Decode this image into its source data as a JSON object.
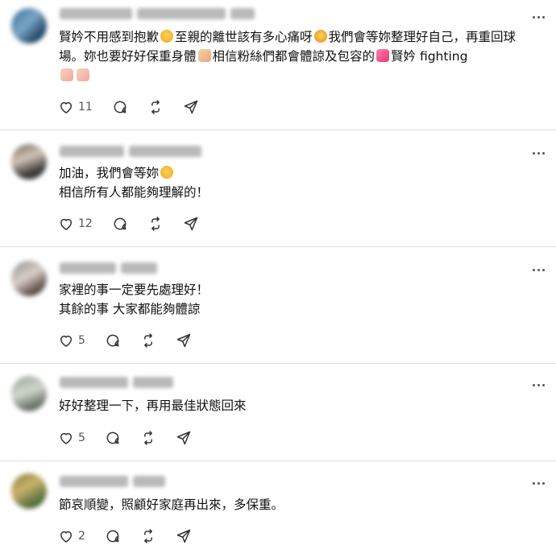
{
  "comments": [
    {
      "text_parts": [
        "賢妗不用感到抱歉",
        "至親的離世該有多心痛呀",
        "我們會等妳整理好自己，再重回球場。妳也要好好保重身體",
        "相信粉絲們都會體諒及包容的",
        "賢妗 fighting"
      ],
      "emojis": [
        "sad-face-emoji",
        "crying-face-emoji",
        "flexed-arm-emoji",
        "two-hearts-emoji",
        "heart-hands-emoji"
      ],
      "likes": "11"
    },
    {
      "text_lines": [
        "加油，我們會等妳",
        "相信所有人都能夠理解的！"
      ],
      "emojis": [
        "smiling-face-emoji"
      ],
      "likes": "12"
    },
    {
      "text_lines": [
        "家裡的事一定要先處理好！",
        "其餘的事 大家都能夠體諒"
      ],
      "likes": "5"
    },
    {
      "text_lines": [
        "好好整理一下，再用最佳狀態回來"
      ],
      "likes": "5"
    },
    {
      "text_lines": [
        "節哀順變，照顧好家庭再出來，多保重。"
      ],
      "likes": "2"
    }
  ],
  "colors": {
    "icon": "#333333",
    "divider": "#dcdcdc",
    "count": "#555555"
  }
}
